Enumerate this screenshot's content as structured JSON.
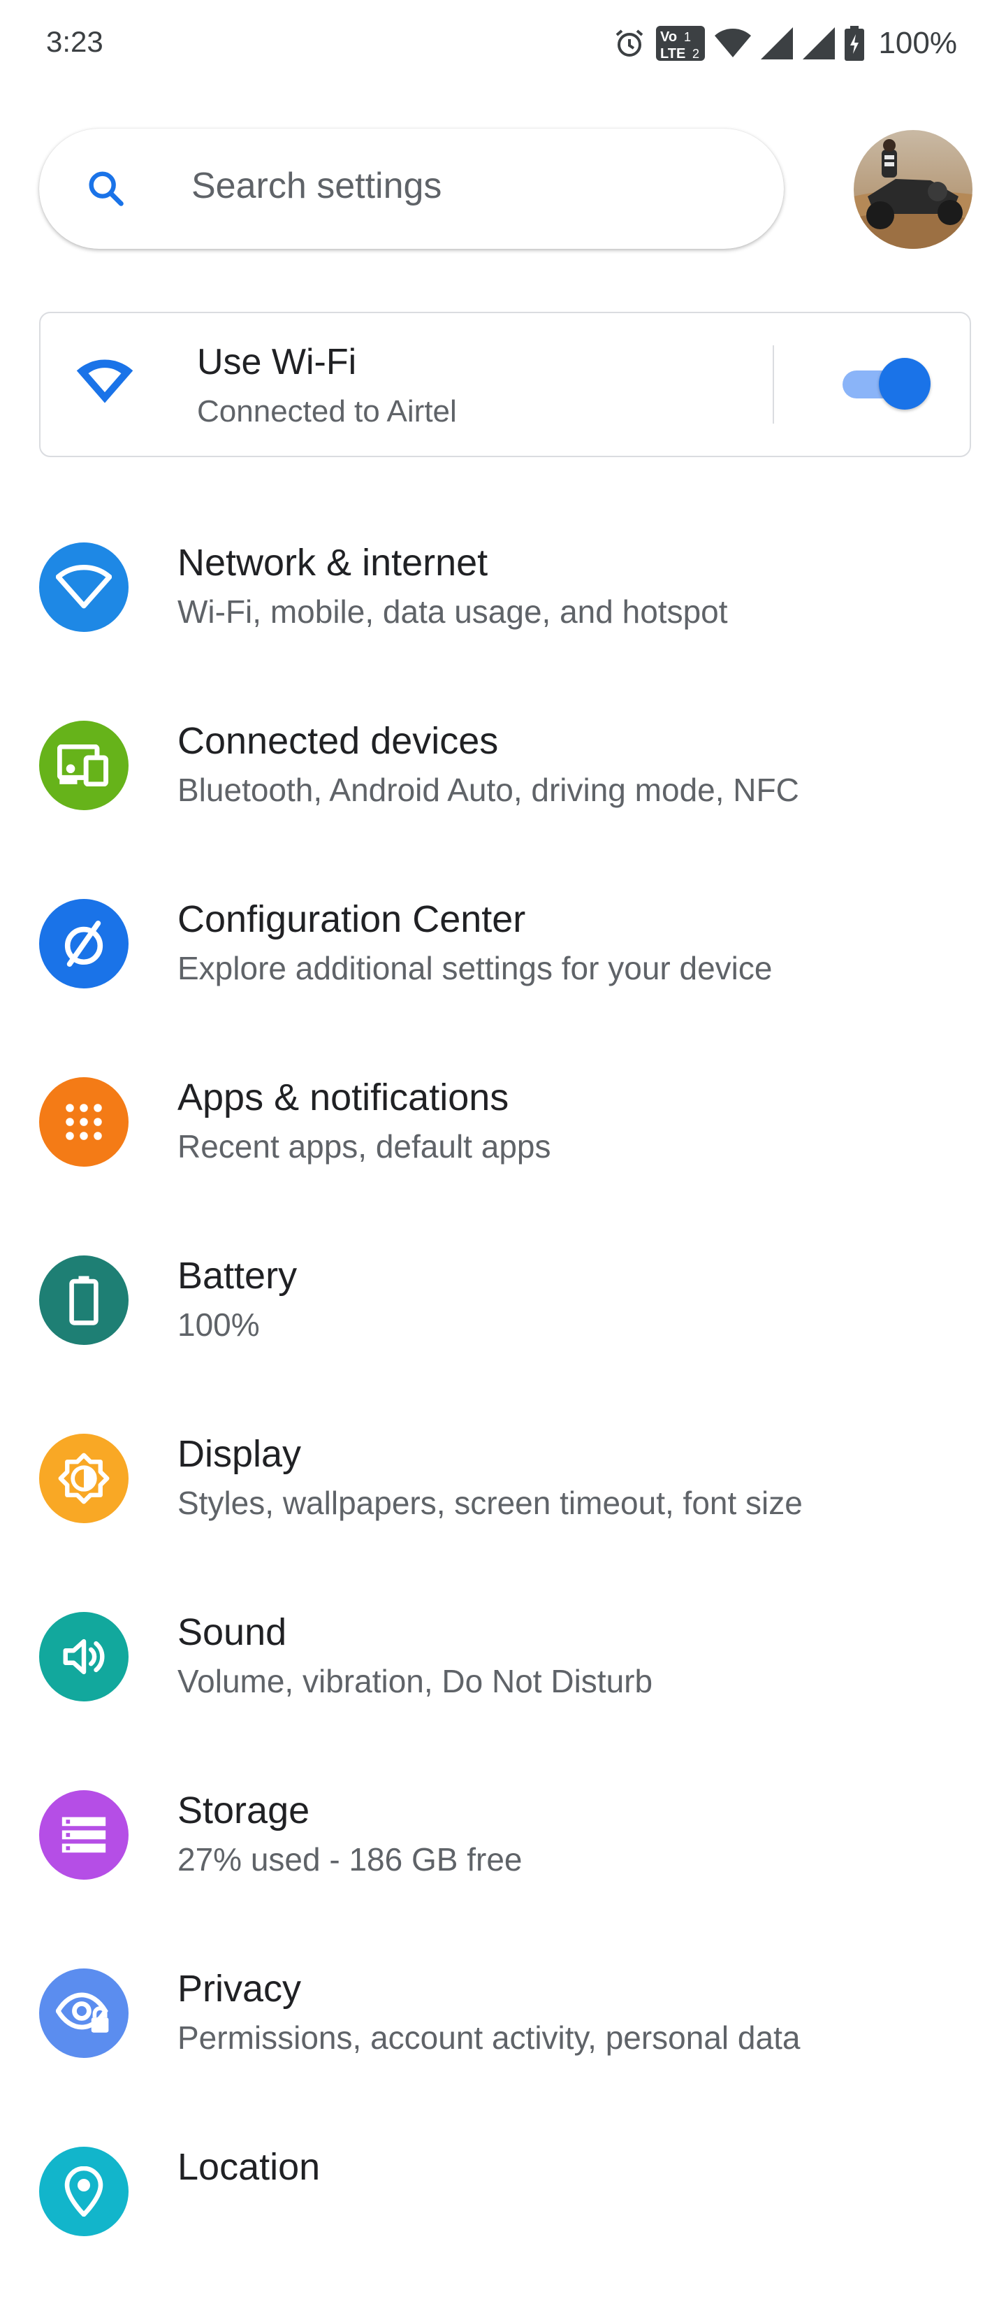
{
  "status_bar": {
    "time": "3:23",
    "battery_text": "100%",
    "icons": [
      "alarm-icon",
      "volte-lte2-icon",
      "wifi-signal-icon",
      "cell-signal-icon",
      "cell-signal-icon",
      "battery-charging-icon"
    ]
  },
  "search": {
    "placeholder": "Search settings"
  },
  "wifi_card": {
    "title": "Use Wi-Fi",
    "subtitle": "Connected to Airtel",
    "toggle_on": true
  },
  "settings": [
    {
      "id": "network",
      "title": "Network & internet",
      "subtitle": "Wi-Fi, mobile, data usage, and hotspot",
      "icon": "wifi-icon",
      "color": "#1e88e5"
    },
    {
      "id": "connected-devices",
      "title": "Connected devices",
      "subtitle": "Bluetooth, Android Auto, driving mode, NFC",
      "icon": "devices-icon",
      "color": "#66b31a"
    },
    {
      "id": "configuration-center",
      "title": "Configuration Center",
      "subtitle": "Explore additional settings for your device",
      "icon": "configuration-icon",
      "color": "#1a73e8"
    },
    {
      "id": "apps",
      "title": "Apps & notifications",
      "subtitle": "Recent apps, default apps",
      "icon": "apps-grid-icon",
      "color": "#f47b16"
    },
    {
      "id": "battery",
      "title": "Battery",
      "subtitle": "100%",
      "icon": "battery-icon",
      "color": "#1e7f74"
    },
    {
      "id": "display",
      "title": "Display",
      "subtitle": "Styles, wallpapers, screen timeout, font size",
      "icon": "brightness-icon",
      "color": "#f9a825"
    },
    {
      "id": "sound",
      "title": "Sound",
      "subtitle": "Volume, vibration, Do Not Disturb",
      "icon": "volume-icon",
      "color": "#12a89d"
    },
    {
      "id": "storage",
      "title": "Storage",
      "subtitle": "27% used - 186 GB free",
      "icon": "storage-icon",
      "color": "#b54ee6"
    },
    {
      "id": "privacy",
      "title": "Privacy",
      "subtitle": "Permissions, account activity, personal data",
      "icon": "privacy-eye-icon",
      "color": "#5b8def"
    },
    {
      "id": "location",
      "title": "Location",
      "subtitle": "",
      "icon": "location-pin-icon",
      "color": "#12b5cb"
    }
  ]
}
